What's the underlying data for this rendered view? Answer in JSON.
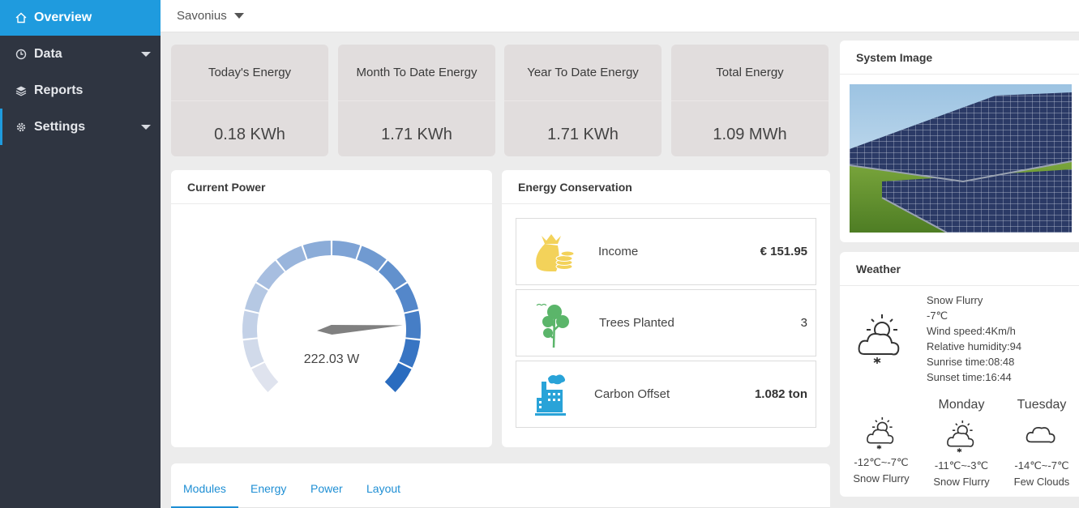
{
  "sidebar": {
    "items": [
      {
        "label": "Overview",
        "icon": "home-icon"
      },
      {
        "label": "Data",
        "icon": "clock-icon"
      },
      {
        "label": "Reports",
        "icon": "layers-icon"
      },
      {
        "label": "Settings",
        "icon": "gear-icon"
      }
    ]
  },
  "topbar": {
    "site": "Savonius"
  },
  "tiles": [
    {
      "label": "Today's Energy",
      "value": "0.18 KWh"
    },
    {
      "label": "Month To Date Energy",
      "value": "1.71 KWh"
    },
    {
      "label": "Year To Date Energy",
      "value": "1.71 KWh"
    },
    {
      "label": "Total Energy",
      "value": "1.09 MWh"
    }
  ],
  "current_power": {
    "title": "Current Power",
    "value": "222.03 W",
    "level": 0.82
  },
  "conservation": {
    "title": "Energy Conservation",
    "rows": [
      {
        "label": "Income",
        "value": "€ 151.95",
        "icon": "money-bag-icon"
      },
      {
        "label": "Trees Planted",
        "value": "3",
        "icon": "tree-icon"
      },
      {
        "label": "Carbon Offset",
        "value": "1.082 ton",
        "icon": "factory-icon"
      }
    ]
  },
  "system_image": {
    "title": "System Image"
  },
  "weather": {
    "title": "Weather",
    "current": {
      "condition": "Snow Flurry",
      "temp": "-7℃",
      "wind": "Wind speed:4Km/h",
      "humidity": "Relative humidity:94",
      "sunrise": "Sunrise time:08:48",
      "sunset": "Sunset time:16:44"
    },
    "forecast": [
      {
        "day": "",
        "temp": "-12℃~-7℃",
        "condition": "Snow Flurry",
        "icon": "snow-cloud-icon"
      },
      {
        "day": "Monday",
        "temp": "-11℃~-3℃",
        "condition": "Snow Flurry",
        "icon": "snow-cloud-icon"
      },
      {
        "day": "Tuesday",
        "temp": "-14℃~-7℃",
        "condition": "Few Clouds",
        "icon": "cloud-icon"
      }
    ]
  },
  "tabs": [
    "Modules",
    "Energy",
    "Power",
    "Layout"
  ],
  "colors": {
    "accent": "#1f9bde",
    "sidebar": "#2f3541",
    "tile": "#e1dddd",
    "gauge_dark": "#2a6cbf",
    "gauge_light": "#dfe3ee"
  }
}
